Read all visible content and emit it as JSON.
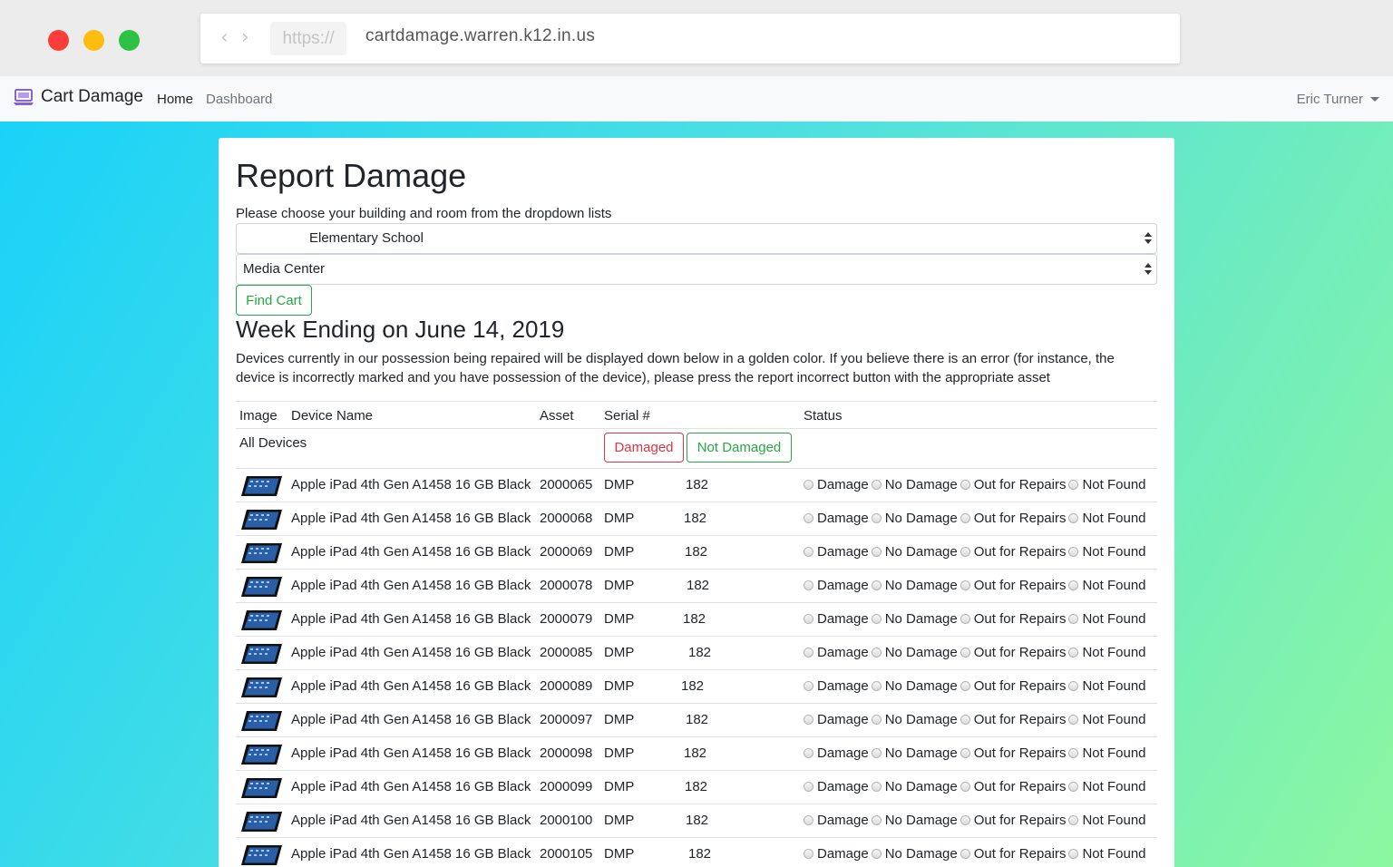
{
  "browser": {
    "protocol": "https://",
    "url": "cartdamage.warren.k12.in.us"
  },
  "navbar": {
    "brand": "Cart Damage",
    "home": "Home",
    "dashboard": "Dashboard",
    "user": "Eric Turner"
  },
  "page": {
    "title": "Report Damage",
    "instruction": "Please choose your building and room from the dropdown lists",
    "building_select": "Elementary School",
    "room_select": "Media Center",
    "find_button": "Find Cart",
    "week_heading": "Week Ending on June 14, 2019",
    "description": "Devices currently in our possession being repaired will be displayed down below in a golden color. If you believe there is an error (for instance, the device is incorrectly marked and you have possession of the device), please press the report incorrect button with the appropriate asset"
  },
  "table": {
    "headers": {
      "image": "Image",
      "device": "Device Name",
      "asset": "Asset",
      "serial": "Serial #",
      "status": "Status"
    },
    "all_devices": "All Devices",
    "damaged_button": "Damaged",
    "not_damaged_button": "Not Damaged",
    "status_options": [
      "Damage",
      "No Damage",
      "Out for Repairs",
      "Not Found"
    ],
    "rows": [
      {
        "device": "Apple iPad 4th Gen A1458 16 GB Black",
        "asset": "2000065",
        "serial_prefix": "DMP",
        "serial_suffix": "182"
      },
      {
        "device": "Apple iPad 4th Gen A1458 16 GB Black",
        "asset": "2000068",
        "serial_prefix": "DMP",
        "serial_suffix": "182"
      },
      {
        "device": "Apple iPad 4th Gen A1458 16 GB Black",
        "asset": "2000069",
        "serial_prefix": "DMP",
        "serial_suffix": "182"
      },
      {
        "device": "Apple iPad 4th Gen A1458 16 GB Black",
        "asset": "2000078",
        "serial_prefix": "DMP",
        "serial_suffix": "182"
      },
      {
        "device": "Apple iPad 4th Gen A1458 16 GB Black",
        "asset": "2000079",
        "serial_prefix": "DMP",
        "serial_suffix": "182"
      },
      {
        "device": "Apple iPad 4th Gen A1458 16 GB Black",
        "asset": "2000085",
        "serial_prefix": "DMP",
        "serial_suffix": "182"
      },
      {
        "device": "Apple iPad 4th Gen A1458 16 GB Black",
        "asset": "2000089",
        "serial_prefix": "DMP",
        "serial_suffix": "182"
      },
      {
        "device": "Apple iPad 4th Gen A1458 16 GB Black",
        "asset": "2000097",
        "serial_prefix": "DMP",
        "serial_suffix": "182"
      },
      {
        "device": "Apple iPad 4th Gen A1458 16 GB Black",
        "asset": "2000098",
        "serial_prefix": "DMP",
        "serial_suffix": "182"
      },
      {
        "device": "Apple iPad 4th Gen A1458 16 GB Black",
        "asset": "2000099",
        "serial_prefix": "DMP",
        "serial_suffix": "182"
      },
      {
        "device": "Apple iPad 4th Gen A1458 16 GB Black",
        "asset": "2000100",
        "serial_prefix": "DMP",
        "serial_suffix": "182"
      },
      {
        "device": "Apple iPad 4th Gen A1458 16 GB Black",
        "asset": "2000105",
        "serial_prefix": "DMP",
        "serial_suffix": "182"
      }
    ]
  },
  "colors": {
    "success": "#28a745",
    "danger": "#dc3545",
    "gradient_start": "#1ad2f8",
    "gradient_end": "#8cf7a0"
  },
  "icons": {
    "brand": "laptop-icon",
    "device_thumbnail": "ipad-icon"
  }
}
